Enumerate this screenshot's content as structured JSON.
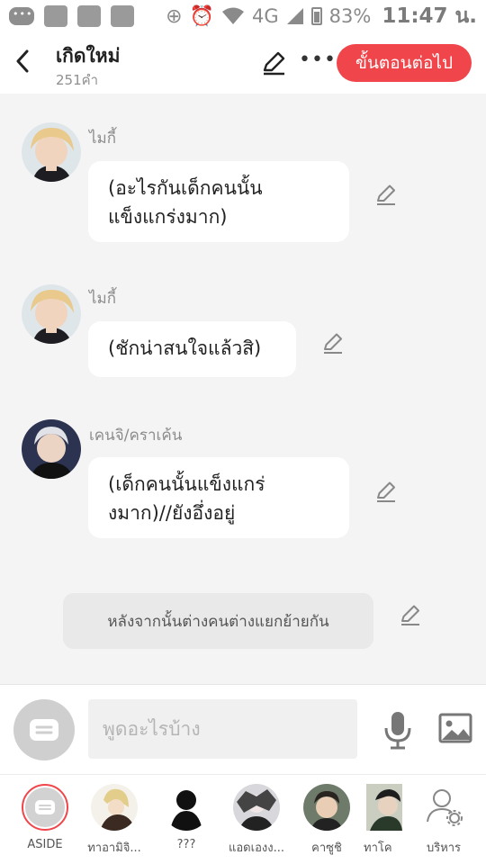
{
  "status_bar": {
    "battery": "83%",
    "time": "11:47 น.",
    "network": "4G"
  },
  "header": {
    "title": "เกิดใหม่",
    "word_count": "251คำ",
    "next_button": "ขั้นตอนต่อไป"
  },
  "messages": [
    {
      "speaker": "ไมกี้",
      "text_lines": [
        "(อะไรกันเด็กคนนั้น",
        "แข็งแกร่งมาก)"
      ]
    },
    {
      "speaker": "ไมกี้",
      "text_lines": [
        "(ชักน่าสนใจแล้วสิ)"
      ]
    },
    {
      "speaker": "เคนจิ/คราเค้น",
      "text_lines": [
        "(เด็กคนนั้นแข็งแกร่",
        "งมาก)//ยังอึ่งอยู่"
      ]
    }
  ],
  "narration": "หลังจากนั้นต่างคนต่างแยกย้ายกัน",
  "input": {
    "placeholder": "พูดอะไรบ้าง"
  },
  "characters": [
    {
      "label": "ASIDE"
    },
    {
      "label": "ทาอามิจิ..."
    },
    {
      "label": "???"
    },
    {
      "label": "แอดเองง..."
    },
    {
      "label": "คาซูชิ"
    },
    {
      "label": "ทาโค"
    },
    {
      "label": "บริหาร"
    }
  ],
  "colors": {
    "accent": "#f0464b",
    "background": "#f4f4f4",
    "bubble": "#ffffff"
  }
}
